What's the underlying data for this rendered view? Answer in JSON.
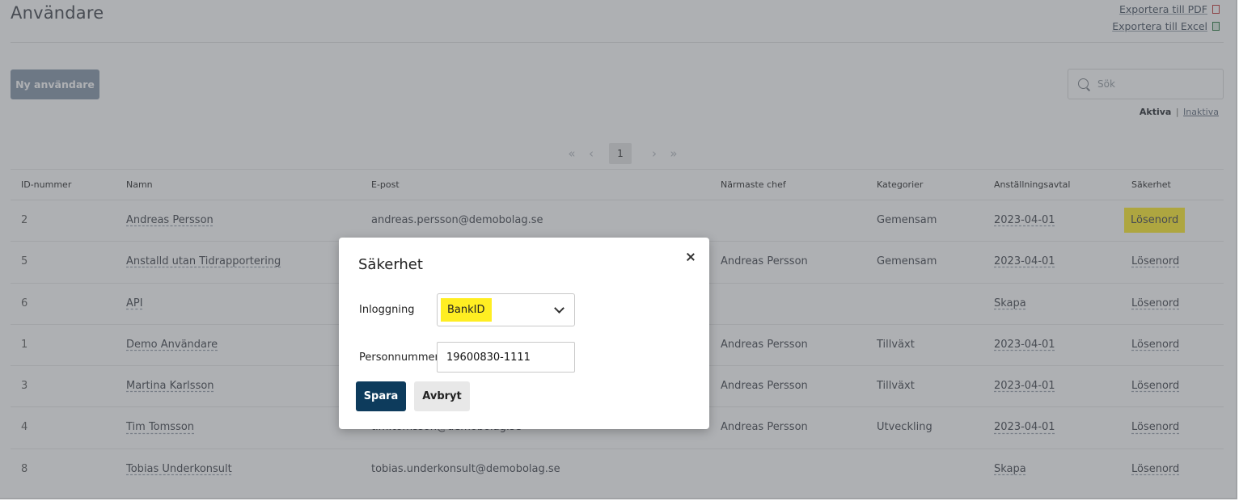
{
  "page": {
    "title": "Användare",
    "export_pdf": "Exportera till PDF",
    "export_excel": "Exportera till Excel",
    "new_user_button": "Ny användare",
    "search_placeholder": "Sök",
    "filter_active": "Aktiva",
    "filter_separator": "|",
    "filter_inactive": "Inaktiva"
  },
  "pagination": {
    "first": "«",
    "prev": "‹",
    "current": "1",
    "next": "›",
    "last": "»"
  },
  "table": {
    "headers": [
      "ID-nummer",
      "Namn",
      "E-post",
      "Närmaste chef",
      "Kategorier",
      "Anställningsavtal",
      "Säkerhet"
    ],
    "rows": [
      {
        "id": "2",
        "name": "Andreas Persson",
        "email": "andreas.persson@demobolag.se",
        "chef": "",
        "kategori": "Gemensam",
        "avtal": "2023-04-01",
        "sakerhet": "Lösenord"
      },
      {
        "id": "5",
        "name": "Anstalld utan Tidrapportering",
        "email": "",
        "chef": "Andreas Persson",
        "kategori": "Gemensam",
        "avtal": "2023-04-01",
        "sakerhet": "Lösenord"
      },
      {
        "id": "6",
        "name": "API",
        "email": "",
        "chef": "",
        "kategori": "",
        "avtal": "Skapa",
        "sakerhet": "Lösenord"
      },
      {
        "id": "1",
        "name": "Demo Användare",
        "email": "",
        "chef": "Andreas Persson",
        "kategori": "Tillväxt",
        "avtal": "2023-04-01",
        "sakerhet": "Lösenord"
      },
      {
        "id": "3",
        "name": "Martina Karlsson",
        "email": "",
        "chef": "Andreas Persson",
        "kategori": "Tillväxt",
        "avtal": "2023-04-01",
        "sakerhet": "Lösenord"
      },
      {
        "id": "4",
        "name": "Tim Tomsson",
        "email": "tim.tomsson@demobolag.se",
        "chef": "Andreas Persson",
        "kategori": "Utveckling",
        "avtal": "2023-04-01",
        "sakerhet": "Lösenord"
      },
      {
        "id": "8",
        "name": "Tobias Underkonsult",
        "email": "tobias.underkonsult@demobolag.se",
        "chef": "",
        "kategori": "",
        "avtal": "Skapa",
        "sakerhet": "Lösenord"
      }
    ]
  },
  "modal": {
    "title": "Säkerhet",
    "login_label": "Inloggning",
    "login_value": "BankID",
    "pnr_label": "Personnummer",
    "pnr_value": "19600830-1111",
    "save_button": "Spara",
    "cancel_button": "Avbryt"
  },
  "colors": {
    "highlight": "#ffee33",
    "primary_button": "#0d3b5c",
    "new_user_button": "#8c9bae",
    "overlay": "rgba(70,74,82,0.44)"
  },
  "icons": {
    "pdf": "pdf-file-icon",
    "excel": "excel-file-icon",
    "search": "search-icon",
    "close": "close-icon",
    "dropdown": "chevron-down-icon"
  }
}
